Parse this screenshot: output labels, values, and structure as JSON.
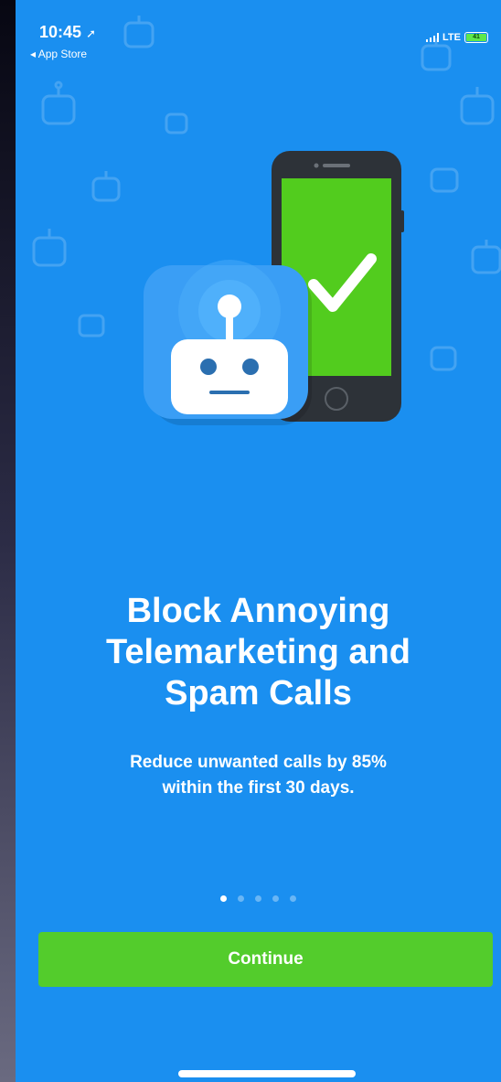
{
  "status_bar": {
    "time": "10:45",
    "back_label": "◂ App Store",
    "network": "LTE",
    "battery": "41"
  },
  "onboarding": {
    "headline_lines": [
      "Block Annoying",
      "Telemarketing and",
      "Spam Calls"
    ],
    "subtitle_lines": [
      "Reduce unwanted calls by 85%",
      "within the first 30 days."
    ],
    "page_count": 5,
    "active_page": 1,
    "continue_label": "Continue"
  },
  "icons": {
    "illustration": "robot-app-and-phone-checkmark-icon",
    "pattern": "robot-pattern-icon",
    "location": "location-arrow-icon",
    "signal": "signal-bars-icon",
    "battery": "battery-icon"
  },
  "colors": {
    "background": "#1a8ff0",
    "button": "#53cc2c",
    "phone_screen": "#52cc1e",
    "app_icon": "#3a9ef5"
  }
}
